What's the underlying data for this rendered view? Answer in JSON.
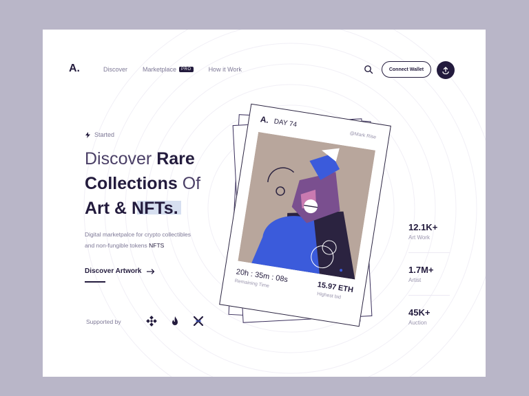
{
  "brand": {
    "logo": "A."
  },
  "nav": {
    "items": [
      {
        "label": "Discover"
      },
      {
        "label": "Marketplace",
        "badge": "PRO"
      },
      {
        "label": "How it Work"
      }
    ]
  },
  "header": {
    "connect_label": "Connect Wallet"
  },
  "hero": {
    "started": "Started",
    "headline": {
      "line1_light": "Discover ",
      "line1_bold": "Rare",
      "line2_bold": "Collections",
      "line2_light": " Of",
      "line3_bold": "Art & NFTs."
    },
    "desc_1": "Digital marketpalce for crypto collectibles",
    "desc_2": "and non-fungible tokens ",
    "desc_bold": "NFTS",
    "cta": "Discover Artwork",
    "supported_label": "Supported by"
  },
  "card": {
    "logo": "A.",
    "day": "DAY 74",
    "handle": "@Mark Rise",
    "timer": "20h : 35m : 08s",
    "timer_label": "Remaining Time",
    "price": "15.97 ETH",
    "price_label": "Highest bid"
  },
  "stats": [
    {
      "value": "12.1K+",
      "label": "Art Work"
    },
    {
      "value": "1.7M+",
      "label": "Artist"
    },
    {
      "value": "45K+",
      "label": "Auction"
    }
  ],
  "icons": {
    "search": "search-icon",
    "upload": "upload-icon",
    "arrow": "arrow-right-icon",
    "bolt": "bolt-icon",
    "supported": [
      "binance-icon",
      "flame-icon",
      "x-icon"
    ]
  },
  "colors": {
    "primary": "#231b3d",
    "muted": "#7d7896",
    "accent_blue": "#3b5bdb",
    "highlight": "#d6dff0",
    "outer_bg": "#b9b6c8"
  }
}
